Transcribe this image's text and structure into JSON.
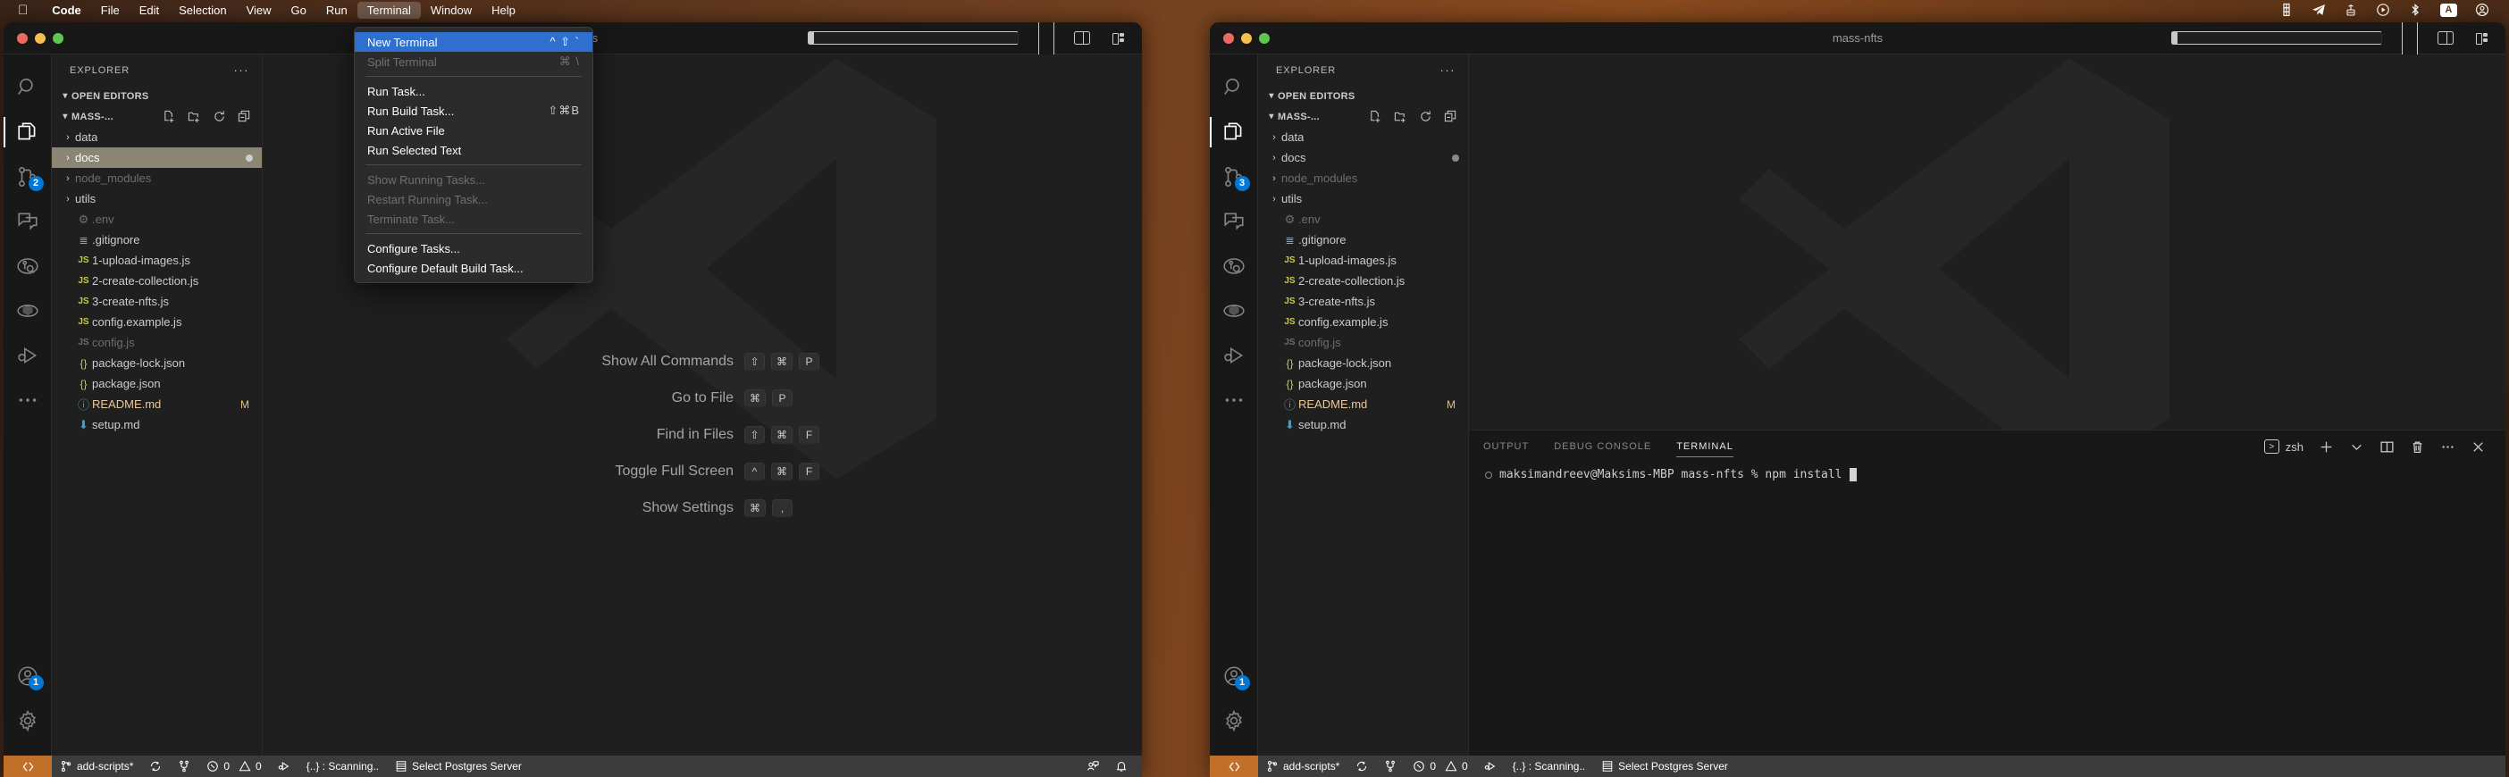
{
  "menubar": {
    "apple_icon": "apple-icon",
    "items": [
      {
        "label": "Code",
        "bold": true,
        "active": false
      },
      {
        "label": "File",
        "bold": false,
        "active": false
      },
      {
        "label": "Edit",
        "bold": false,
        "active": false
      },
      {
        "label": "Selection",
        "bold": false,
        "active": false
      },
      {
        "label": "View",
        "bold": false,
        "active": false
      },
      {
        "label": "Go",
        "bold": false,
        "active": false
      },
      {
        "label": "Run",
        "bold": false,
        "active": false
      },
      {
        "label": "Terminal",
        "bold": false,
        "active": true
      },
      {
        "label": "Window",
        "bold": false,
        "active": false
      },
      {
        "label": "Help",
        "bold": false,
        "active": false
      }
    ],
    "tray": [
      {
        "name": "figma-icon",
        "glyph": "☰"
      },
      {
        "name": "telegram-icon",
        "glyph": "➤"
      },
      {
        "name": "network-antenna-icon",
        "glyph": "὎1"
      },
      {
        "name": "media-play-icon",
        "glyph": "▶"
      },
      {
        "name": "bluetooth-icon",
        "glyph": "ᛦ"
      },
      {
        "name": "keyboard-layout-icon",
        "glyph": "A"
      },
      {
        "name": "control-center-user-icon",
        "glyph": "●"
      }
    ]
  },
  "terminal_menu": {
    "items": [
      {
        "label": "New Terminal",
        "shortcut": "^ ⇧ `",
        "state": "selected"
      },
      {
        "label": "Split Terminal",
        "shortcut": "⌘ \\",
        "state": "disabled"
      },
      {
        "sep": true
      },
      {
        "label": "Run Task...",
        "shortcut": "",
        "state": "normal"
      },
      {
        "label": "Run Build Task...",
        "shortcut": "⇧⌘B",
        "state": "normal"
      },
      {
        "label": "Run Active File",
        "shortcut": "",
        "state": "normal"
      },
      {
        "label": "Run Selected Text",
        "shortcut": "",
        "state": "normal"
      },
      {
        "sep": true
      },
      {
        "label": "Show Running Tasks...",
        "shortcut": "",
        "state": "disabled"
      },
      {
        "label": "Restart Running Task...",
        "shortcut": "",
        "state": "disabled"
      },
      {
        "label": "Terminate Task...",
        "shortcut": "",
        "state": "disabled"
      },
      {
        "sep": true
      },
      {
        "label": "Configure Tasks...",
        "shortcut": "",
        "state": "normal"
      },
      {
        "label": "Configure Default Build Task...",
        "shortcut": "",
        "state": "normal"
      }
    ]
  },
  "window_left": {
    "title": "mass-nfts",
    "traffic_lights": [
      "close",
      "minimize",
      "zoom"
    ],
    "layout_icons": [
      {
        "name": "toggle-primary-sidebar-icon",
        "active": true
      },
      {
        "name": "toggle-panel-icon",
        "active": false
      },
      {
        "name": "toggle-secondary-sidebar-icon",
        "active": false
      },
      {
        "name": "customize-layout-icon",
        "active": false
      }
    ],
    "activity_bar": [
      {
        "name": "search-icon",
        "label": "Search",
        "active": false,
        "badge": ""
      },
      {
        "name": "explorer-icon",
        "label": "Explorer",
        "active": true,
        "badge": ""
      },
      {
        "name": "source-control-icon",
        "label": "Source Control",
        "active": false,
        "badge": "2"
      },
      {
        "name": "chat-icon",
        "label": "Chat",
        "active": false,
        "badge": ""
      },
      {
        "name": "testing-icon",
        "label": "Testing",
        "active": false,
        "badge": ""
      },
      {
        "name": "extensions-hex-icon",
        "label": "Extensions",
        "active": false,
        "badge": ""
      },
      {
        "name": "run-and-debug-icon",
        "label": "Run and Debug",
        "active": false,
        "badge": ""
      },
      {
        "name": "more-actions-icon",
        "label": "Additional Views",
        "active": false,
        "badge": ""
      }
    ],
    "activity_bar_bottom": [
      {
        "name": "accounts-icon",
        "label": "Accounts",
        "badge": "1"
      },
      {
        "name": "manage-settings-gear-icon",
        "label": "Manage",
        "badge": ""
      }
    ],
    "sidebar": {
      "header": "EXPLORER",
      "more_actions": "···",
      "open_editors_label": "OPEN EDITORS",
      "project_label": "MASS-...",
      "project_actions": [
        {
          "name": "new-file-icon"
        },
        {
          "name": "new-folder-icon"
        },
        {
          "name": "refresh-explorer-icon"
        },
        {
          "name": "collapse-folders-icon"
        }
      ],
      "tree": [
        {
          "name": "data",
          "type": "folder",
          "icon": "chevron-right-icon",
          "selected": false,
          "dim": false,
          "flag": ""
        },
        {
          "name": "docs",
          "type": "folder",
          "icon": "chevron-right-icon",
          "selected": true,
          "dim": false,
          "flag": "dot"
        },
        {
          "name": "node_modules",
          "type": "folder",
          "icon": "chevron-right-icon",
          "selected": false,
          "dim": true,
          "flag": ""
        },
        {
          "name": "utils",
          "type": "folder",
          "icon": "chevron-right-icon",
          "selected": false,
          "dim": false,
          "flag": ""
        },
        {
          "name": ".env",
          "type": "file",
          "icon": "gear-file-icon",
          "selected": false,
          "dim": true,
          "flag": ""
        },
        {
          "name": ".gitignore",
          "type": "file",
          "icon": "config-lines-icon",
          "selected": false,
          "dim": false,
          "flag": ""
        },
        {
          "name": "1-upload-images.js",
          "type": "file",
          "icon": "js-file-icon",
          "selected": false,
          "dim": false,
          "flag": ""
        },
        {
          "name": "2-create-collection.js",
          "type": "file",
          "icon": "js-file-icon",
          "selected": false,
          "dim": false,
          "flag": ""
        },
        {
          "name": "3-create-nfts.js",
          "type": "file",
          "icon": "js-file-icon",
          "selected": false,
          "dim": false,
          "flag": ""
        },
        {
          "name": "config.example.js",
          "type": "file",
          "icon": "js-file-icon",
          "selected": false,
          "dim": false,
          "flag": ""
        },
        {
          "name": "config.js",
          "type": "file",
          "icon": "js-file-icon",
          "selected": false,
          "dim": true,
          "flag": ""
        },
        {
          "name": "package-lock.json",
          "type": "file",
          "icon": "json-file-icon",
          "selected": false,
          "dim": false,
          "flag": ""
        },
        {
          "name": "package.json",
          "type": "file",
          "icon": "json-file-icon",
          "selected": false,
          "dim": false,
          "flag": ""
        },
        {
          "name": "README.md",
          "type": "file",
          "icon": "info-md-file-icon",
          "selected": false,
          "dim": false,
          "flag": "M"
        },
        {
          "name": "setup.md",
          "type": "file",
          "icon": "download-md-file-icon",
          "selected": false,
          "dim": false,
          "flag": ""
        }
      ]
    },
    "watermark_hints": [
      {
        "label": "Show All Commands",
        "keys": [
          "⇧",
          "⌘",
          "P"
        ]
      },
      {
        "label": "Go to File",
        "keys": [
          "⌘",
          "P"
        ]
      },
      {
        "label": "Find in Files",
        "keys": [
          "⇧",
          "⌘",
          "F"
        ]
      },
      {
        "label": "Toggle Full Screen",
        "keys": [
          "^",
          "⌘",
          "F"
        ]
      },
      {
        "label": "Show Settings",
        "keys": [
          "⌘",
          ","
        ]
      }
    ],
    "statusbar": {
      "remote_icon": "remote-window-icon",
      "branch": "add-scripts*",
      "sync_icon": "sync-changes-icon",
      "merge_icon": "checkout-branch-icon",
      "errors": "0",
      "warnings": "0",
      "ports_icon": "ports-forward-icon",
      "task_label": "{..} : Scanning..",
      "postgres_label": "Select Postgres Server",
      "right_icons": [
        {
          "name": "live-share-account-icon"
        },
        {
          "name": "notifications-bell-icon"
        }
      ]
    }
  },
  "window_right": {
    "title": "mass-nfts",
    "layout_icons": [
      {
        "name": "toggle-primary-sidebar-icon",
        "active": true
      },
      {
        "name": "toggle-panel-icon",
        "active": true
      },
      {
        "name": "toggle-secondary-sidebar-icon",
        "active": false
      },
      {
        "name": "customize-layout-icon",
        "active": false
      }
    ],
    "activity_bar": [
      {
        "name": "search-icon",
        "label": "Search",
        "active": false,
        "badge": ""
      },
      {
        "name": "explorer-icon",
        "label": "Explorer",
        "active": true,
        "badge": ""
      },
      {
        "name": "source-control-icon",
        "label": "Source Control",
        "active": false,
        "badge": "3"
      },
      {
        "name": "chat-icon",
        "label": "Chat",
        "active": false,
        "badge": ""
      },
      {
        "name": "testing-icon",
        "label": "Testing",
        "active": false,
        "badge": ""
      },
      {
        "name": "extensions-hex-icon",
        "label": "Extensions",
        "active": false,
        "badge": ""
      },
      {
        "name": "run-and-debug-icon",
        "label": "Run and Debug",
        "active": false,
        "badge": ""
      },
      {
        "name": "more-actions-icon",
        "label": "Additional Views",
        "active": false,
        "badge": ""
      }
    ],
    "activity_bar_bottom": [
      {
        "name": "accounts-icon",
        "label": "Accounts",
        "badge": "1"
      },
      {
        "name": "manage-settings-gear-icon",
        "label": "Manage",
        "badge": ""
      }
    ],
    "panel": {
      "tabs": [
        {
          "label": "OUTPUT",
          "active": false
        },
        {
          "label": "DEBUG CONSOLE",
          "active": false
        },
        {
          "label": "TERMINAL",
          "active": true
        }
      ],
      "shell_label": "zsh",
      "actions": [
        {
          "name": "new-terminal-plus-icon"
        },
        {
          "name": "terminal-profile-chevron-down-icon"
        },
        {
          "name": "split-terminal-icon"
        },
        {
          "name": "kill-terminal-trash-icon"
        },
        {
          "name": "terminal-more-actions-icon"
        },
        {
          "name": "close-panel-icon"
        }
      ],
      "terminal_prompt": "maksimandreev@Maksims-MBP mass-nfts % npm install"
    }
  },
  "colors": {
    "accent_blue": "#0078d4",
    "menu_selection": "#2f6fd0",
    "remote_orange": "#c1702a",
    "statusbar_bg": "#3c3c3c",
    "editor_bg": "#1f1f1f",
    "sidebar_bg": "#1f1f1f",
    "activitybar_bg": "#181818",
    "js_yellow": "#cbcb41",
    "modified_flag": "#e2c08d",
    "tree_selected_bg": "#8b8574"
  }
}
